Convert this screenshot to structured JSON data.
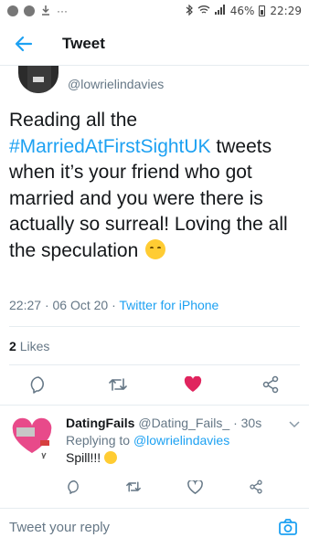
{
  "status_bar": {
    "left_icons": [
      "messenger-icon",
      "chat-icon",
      "download-icon"
    ],
    "more": "···",
    "battery": "46%",
    "time": "22:29"
  },
  "header": {
    "title": "Tweet"
  },
  "tweet": {
    "handle": "@lowrielindavies",
    "text_before": "Reading all the ",
    "hashtag": "#MarriedAtFirstSightUK",
    "text_after": " tweets when it’s your friend who got married and you were there is actually so surreal! Loving the all the speculation ",
    "time": "22:27",
    "date": "06 Oct 20",
    "source": "Twitter for iPhone",
    "likes_count": "2",
    "likes_label": "Likes"
  },
  "reply": {
    "name": "DatingFails",
    "handle": "@Dating_Fails_",
    "age": "30s",
    "replying_label": "Replying to ",
    "replying_handle": "@lowrielindavies",
    "text": "Spill!!! "
  },
  "compose": {
    "placeholder": "Tweet your reply"
  },
  "colors": {
    "accent": "#1da1f2",
    "like": "#e0245e",
    "muted": "#657786"
  }
}
